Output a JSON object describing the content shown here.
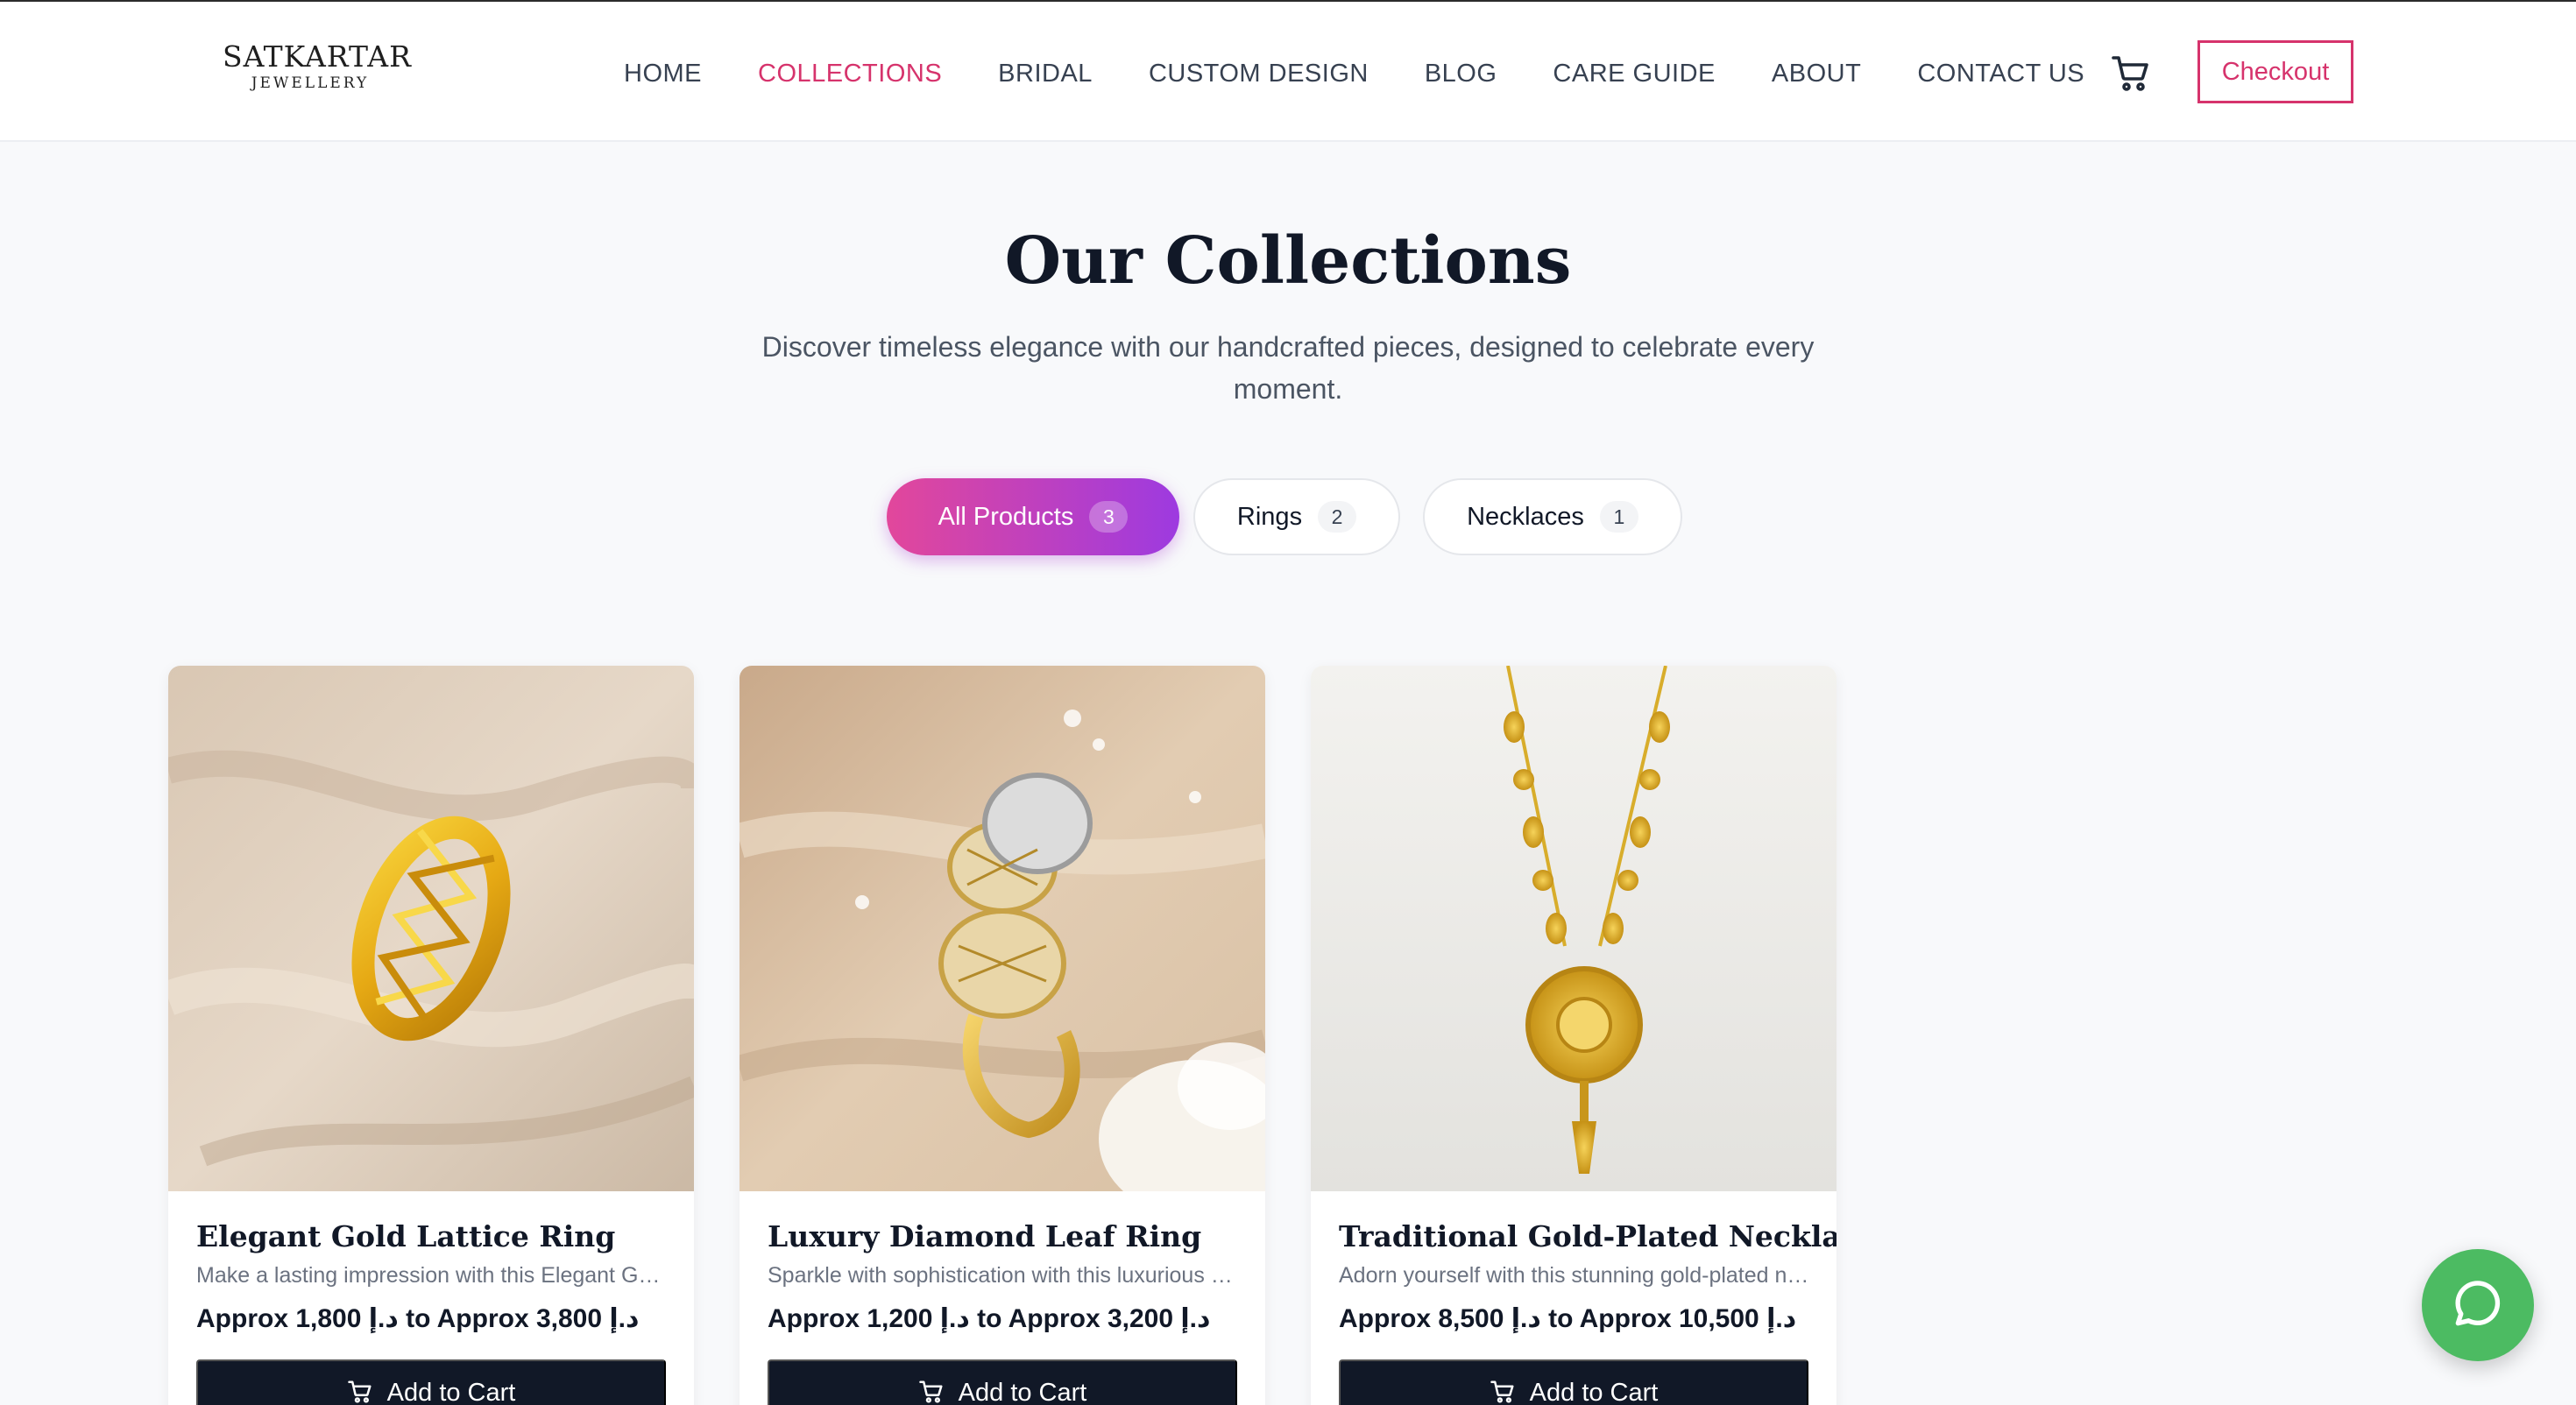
{
  "header": {
    "logo_main": "SATKARTAR",
    "logo_sub": "JEWELLERY",
    "nav": [
      {
        "label": "HOME",
        "active": false
      },
      {
        "label": "COLLECTIONS",
        "active": true
      },
      {
        "label": "BRIDAL",
        "active": false
      },
      {
        "label": "CUSTOM DESIGN",
        "active": false
      },
      {
        "label": "BLOG",
        "active": false
      },
      {
        "label": "CARE GUIDE",
        "active": false
      },
      {
        "label": "ABOUT",
        "active": false
      },
      {
        "label": "CONTACT US",
        "active": false
      }
    ],
    "checkout_label": "Checkout",
    "cart_icon": "shopping-cart-icon"
  },
  "hero": {
    "title": "Our Collections",
    "subtitle": "Discover timeless elegance with our handcrafted pieces, designed to celebrate every moment."
  },
  "filters": [
    {
      "label": "All Products",
      "count": "3",
      "active": true
    },
    {
      "label": "Rings",
      "count": "2",
      "active": false
    },
    {
      "label": "Necklaces",
      "count": "1",
      "active": false
    }
  ],
  "products": [
    {
      "title": "Elegant Gold Lattice Ring",
      "description": "Make a lasting impression with this Elegant Gold Lattice Ring",
      "price": "Approx 1,800 د.إ to Approx 3,800 د.إ",
      "button_label": "Add to Cart"
    },
    {
      "title": "Luxury Diamond Leaf Ring",
      "description": "Sparkle with sophistication with this luxurious diamond leaf ring",
      "price": "Approx 1,200 د.إ to Approx 3,200 د.إ",
      "button_label": "Add to Cart"
    },
    {
      "title": "Traditional Gold-Plated Necklace",
      "description": "Adorn yourself with this stunning gold-plated necklace",
      "price": "Approx 8,500 د.إ to Approx 10,500 د.إ",
      "button_label": "Add to Cart"
    }
  ],
  "colors": {
    "accent": "#d6336c",
    "chip_gradient_start": "#e2479b",
    "chip_gradient_end": "#9d3ae0",
    "button_dark": "#111827",
    "chat_green": "#4cbb62"
  },
  "chat_icon": "whatsapp-chat-icon"
}
